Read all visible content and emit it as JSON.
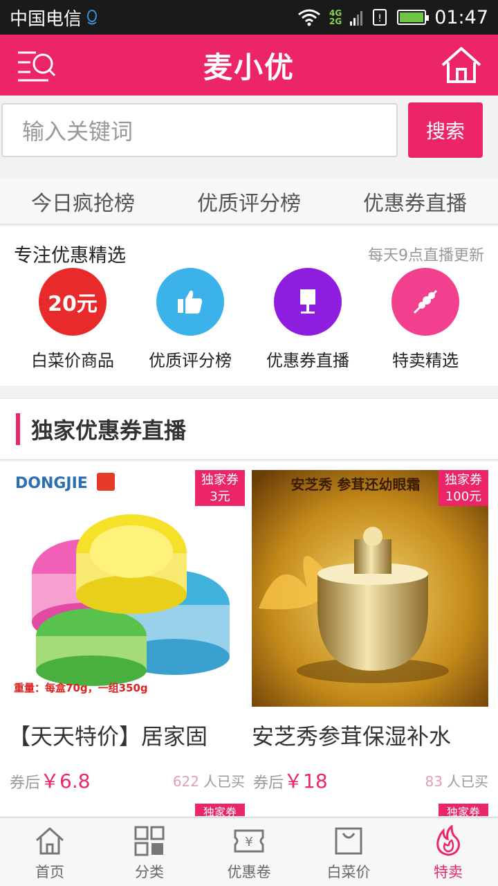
{
  "status_bar": {
    "carrier": "中国电信",
    "network_top": "4G",
    "network_bottom": "2G",
    "time": "01:47"
  },
  "header": {
    "title": "麦小优",
    "menu_icon": "search-menu-icon",
    "home_icon": "home-icon"
  },
  "search": {
    "placeholder": "输入关键词",
    "button_label": "搜索"
  },
  "tabs": [
    {
      "label": "今日疯抢榜"
    },
    {
      "label": "优质评分榜"
    },
    {
      "label": "优惠券直播"
    }
  ],
  "feature": {
    "heading": "专注优惠精选",
    "note": "每天9点直播更新",
    "categories": [
      {
        "label": "白菜价商品",
        "badge_text": "20元",
        "color": "#e92a2a"
      },
      {
        "label": "优质评分榜",
        "icon": "thumbs-up-icon",
        "color": "#3bb2ea"
      },
      {
        "label": "优惠券直播",
        "icon": "lamp-icon",
        "color": "#8f1de0"
      },
      {
        "label": "特卖精选",
        "icon": "skewer-icon",
        "color": "#f23f8e"
      }
    ]
  },
  "section": {
    "title": "独家优惠券直播"
  },
  "products": [
    {
      "badge_line1": "独家券",
      "badge_line2": "3元",
      "brand_text": "DONGJIE",
      "image_caption": "重量：每盒70g，一组350g",
      "name": "【天天特价】居家固",
      "price_prefix": "券后",
      "price": "￥6.8",
      "sold_count": "622",
      "sold_suffix": "人已买"
    },
    {
      "badge_line1": "独家券",
      "badge_line2": "100元",
      "image_banner": "安芝秀  参茸还幼眼霜",
      "name": "安芝秀参茸保湿补水",
      "price_prefix": "券后",
      "price": "￥18",
      "sold_count": "83",
      "sold_suffix": "人已买"
    }
  ],
  "peek_badge": "独家券",
  "bottom_nav": [
    {
      "label": "首页",
      "icon": "home-icon"
    },
    {
      "label": "分类",
      "icon": "grid-icon"
    },
    {
      "label": "优惠卷",
      "icon": "coupon-icon"
    },
    {
      "label": "白菜价",
      "icon": "bag-icon"
    },
    {
      "label": "特卖",
      "icon": "flame-icon",
      "active": true
    }
  ],
  "colors": {
    "accent": "#ec2566",
    "status_bar": "#1a1a1a"
  }
}
